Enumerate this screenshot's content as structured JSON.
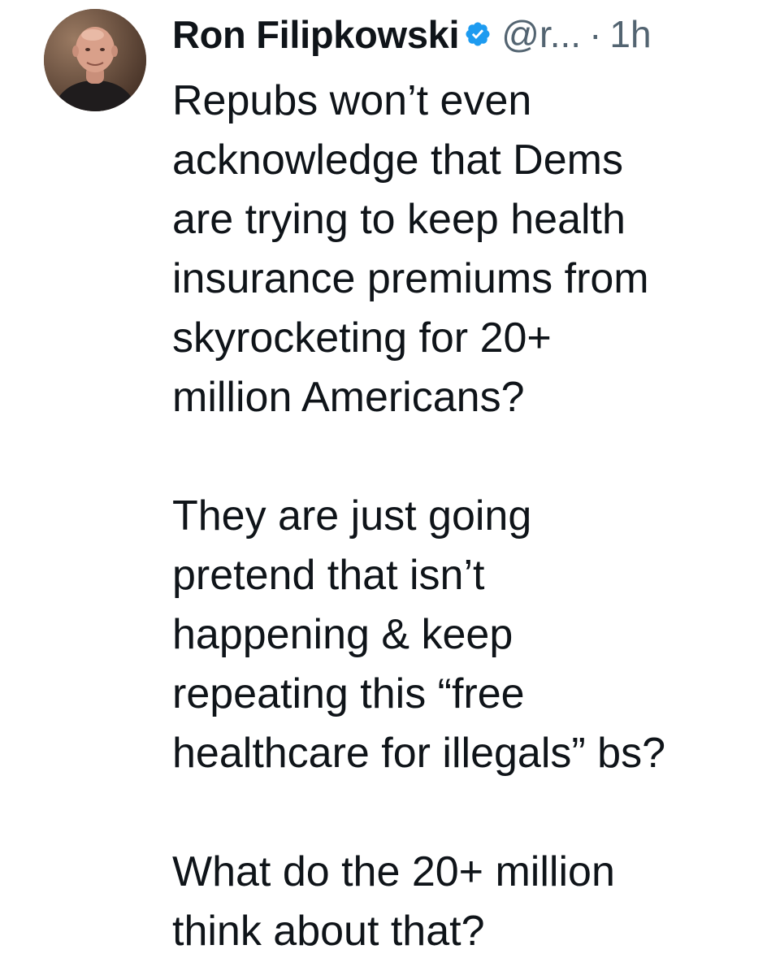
{
  "tweet": {
    "display_name": "Ron Filipkowski",
    "handle": "@r...",
    "separator": "·",
    "time": "1h",
    "verified_icon": "verified-badge-icon",
    "paragraphs": [
      {
        "lines": [
          "Repubs won’t even",
          "acknowledge that Dems",
          "are trying to keep health",
          "insurance premiums from",
          "skyrocketing for 20+",
          "million Americans?"
        ]
      },
      {
        "lines": [
          "They are just going",
          "pretend that isn’t",
          "happening & keep",
          "repeating this “free",
          "healthcare for illegals” bs?"
        ]
      },
      {
        "lines": [
          "What do the 20+ million",
          "think about that?"
        ]
      }
    ]
  },
  "colors": {
    "text": "#0f1419",
    "secondary": "#536471",
    "verified": "#1d9bf0",
    "background": "#ffffff"
  }
}
